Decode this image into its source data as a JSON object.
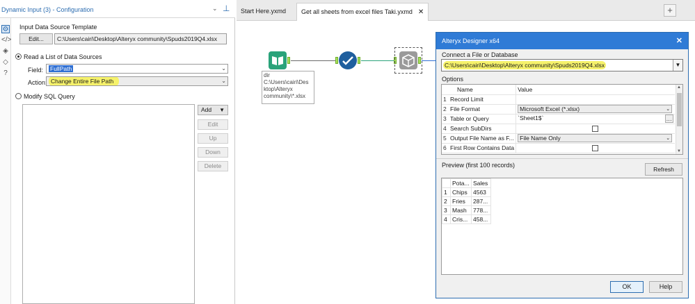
{
  "config": {
    "title": "Dynamic Input (3) - Configuration",
    "template_label": "Input Data Source Template",
    "edit_label": "Edit...",
    "template_path": "C:\\Users\\cairi\\Desktop\\Alteryx community\\Spuds2019Q4.xlsx",
    "read_list_label": "Read a List of Data Sources",
    "field_label": "Field:",
    "field_value": "FullPath",
    "action_label": "Action:",
    "action_value": "Change Entire File Path",
    "modify_sql_label": "Modify SQL Query",
    "add_label": "Add",
    "edit2_label": "Edit",
    "up_label": "Up",
    "down_label": "Down",
    "delete_label": "Delete"
  },
  "tabs": [
    {
      "label": "Start Here.yxmd"
    },
    {
      "label": "Get all sheets from excel files Taki.yxmd"
    }
  ],
  "tab_add": "+",
  "tab_close": "✕",
  "canvas": {
    "annotation": "dir\nC:\\Users\\cairi\\Des\nktop\\Alteryx\ncommunity\\*.xlsx"
  },
  "dialog": {
    "title": "Alteryx Designer x64",
    "close": "✕",
    "connect_label": "Connect a File or Database",
    "connect_value": "C:\\Users\\cairi\\Desktop\\Alteryx community\\Spuds2019Q4.xlsx",
    "options_label": "Options",
    "options_header": {
      "name": "Name",
      "value": "Value"
    },
    "options": [
      {
        "num": "1",
        "name": "Record Limit",
        "value": ""
      },
      {
        "num": "2",
        "name": "File Format",
        "value": "Microsoft Excel (*.xlsx)"
      },
      {
        "num": "3",
        "name": "Table or Query",
        "value": "`Sheet1$`"
      },
      {
        "num": "4",
        "name": "Search SubDirs",
        "value": ""
      },
      {
        "num": "5",
        "name": "Output File Name as F...",
        "value": "File Name Only"
      },
      {
        "num": "6",
        "name": "First Row Contains Data",
        "value": ""
      }
    ],
    "preview_label": "Preview (first 100 records)",
    "refresh_label": "Refresh",
    "preview_header": [
      "",
      "Pota...",
      "Sales"
    ],
    "preview_rows": [
      [
        "1",
        "Chips",
        "4563"
      ],
      [
        "2",
        "Fries",
        "287..."
      ],
      [
        "3",
        "Mash",
        "778..."
      ],
      [
        "4",
        "Cris...",
        "458..."
      ]
    ],
    "ok_label": "OK",
    "help_label": "Help"
  },
  "colors": {
    "accent": "#2f7bd6",
    "highlight": "#f6f26b",
    "input_tool": "#2aa37a",
    "filter_tool": "#1f5f9e"
  },
  "icons": [
    "gear-icon",
    "xml-icon",
    "connections-icon",
    "tag-icon",
    "help-icon",
    "book-icon",
    "check-icon",
    "cube-icon",
    "pin-icon"
  ]
}
